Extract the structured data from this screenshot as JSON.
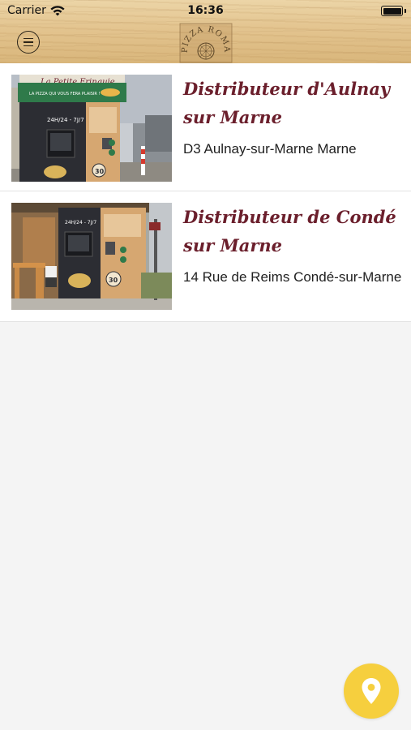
{
  "status_bar": {
    "carrier": "Carrier",
    "time": "16:36"
  },
  "header": {
    "logo_text": "PIZZA ROMA",
    "menu_icon": "hamburger-circle-icon"
  },
  "distributors": [
    {
      "title": "Distributeur d'Aulnay sur Marne",
      "address": "D3 Aulnay-sur-Marne Marne",
      "photo_sign": "La Petite Frinquie",
      "photo_banner": "LA PIZZA QUI VOUS FERA PLAISIR !",
      "photo_hours": "24H/24 - 7J/7",
      "photo_badge": "30"
    },
    {
      "title": "Distributeur de Condé sur Marne",
      "address": "14 Rue de Reims Condé-sur-Marne",
      "photo_hours": "24H/24 - 7J/7",
      "photo_badge": "30"
    }
  ],
  "fab": {
    "icon": "map-pin-icon"
  },
  "colors": {
    "title": "#6b1f2c",
    "fab": "#f6cf3e",
    "background": "#f4f4f4"
  }
}
